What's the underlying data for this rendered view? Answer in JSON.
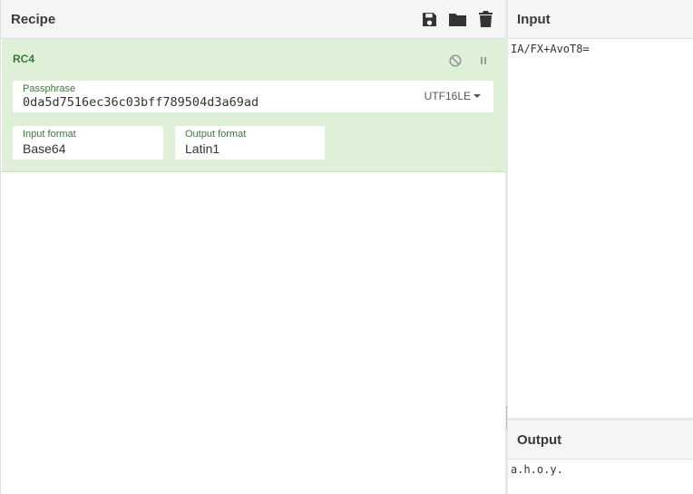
{
  "recipe": {
    "title": "Recipe",
    "actions": [
      {
        "icon": "save-icon"
      },
      {
        "icon": "folder-icon"
      },
      {
        "icon": "trash-icon"
      }
    ],
    "operation": {
      "name": "RC4",
      "passphrase": {
        "label": "Passphrase",
        "value": "0da5d7516ec36c03bff789504d3a69ad",
        "encoding": "UTF16LE"
      },
      "input_format": {
        "label": "Input format",
        "value": "Base64"
      },
      "output_format": {
        "label": "Output format",
        "value": "Latin1"
      }
    }
  },
  "input": {
    "title": "Input",
    "text": "IA/FX+AvoT8="
  },
  "output": {
    "title": "Output",
    "text": "a.h.o.y."
  },
  "colors": {
    "operation_bg": "#dff0d8",
    "operation_accent": "#3c763d"
  }
}
